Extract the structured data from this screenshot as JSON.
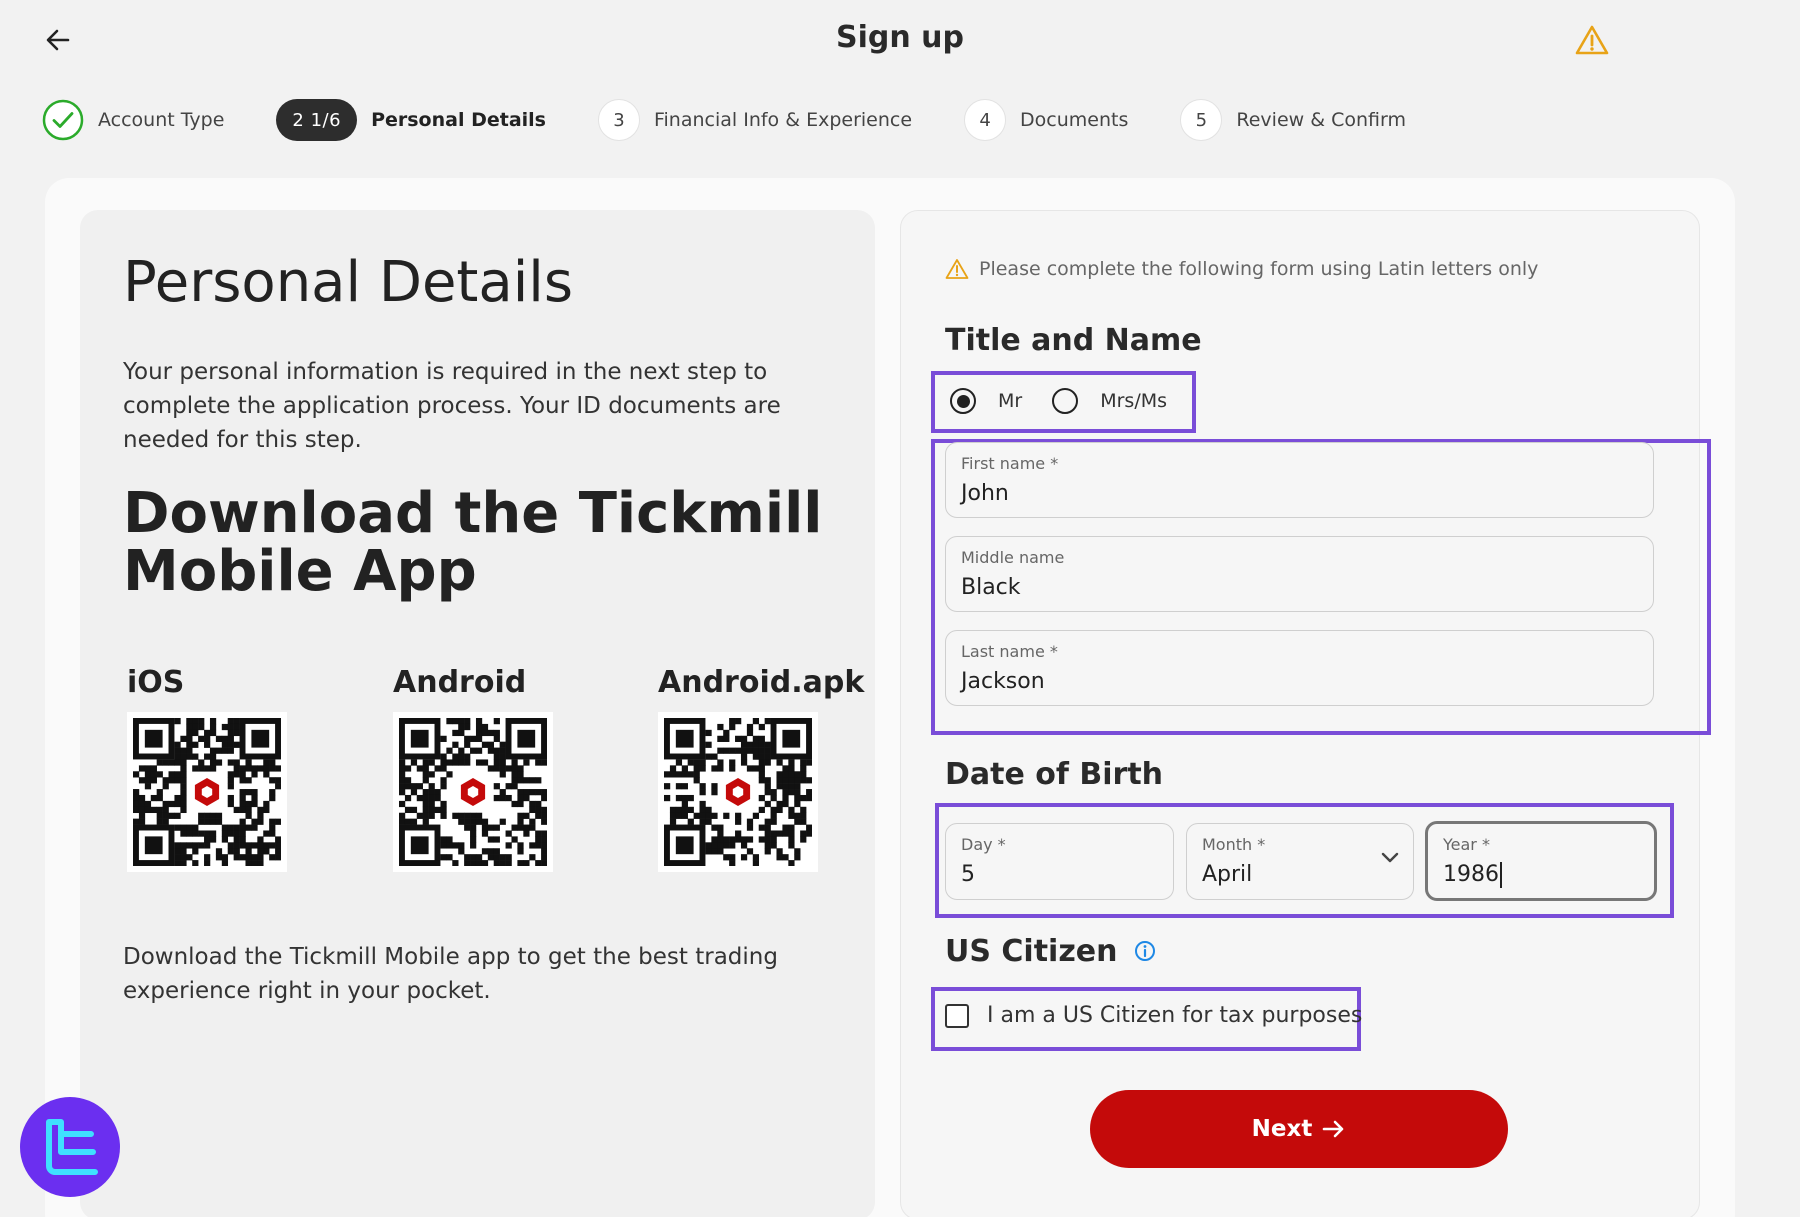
{
  "header": {
    "title": "Sign up"
  },
  "stepper": {
    "steps": [
      {
        "num": "",
        "label": "Account Type",
        "state": "done"
      },
      {
        "num": "2  1/6",
        "label": "Personal Details",
        "state": "active"
      },
      {
        "num": "3",
        "label": "Financial Info & Experience",
        "state": "pending"
      },
      {
        "num": "4",
        "label": "Documents",
        "state": "pending"
      },
      {
        "num": "5",
        "label": "Review & Confirm",
        "state": "pending"
      }
    ]
  },
  "left": {
    "heading": "Personal Details",
    "intro": "Your personal information is required in the next step to complete the application process. Your ID documents are needed for this step.",
    "download_heading": "Download the Tickmill Mobile App",
    "qr": [
      {
        "label": "iOS"
      },
      {
        "label": "Android"
      },
      {
        "label": "Android.apk"
      }
    ],
    "outro": "Download the Tickmill Mobile app to get the best trading experience right in your pocket."
  },
  "form": {
    "notice": "Please complete the following form using Latin letters only",
    "title_section": "Title and Name",
    "title_options": [
      {
        "label": "Mr",
        "selected": true
      },
      {
        "label": "Mrs/Ms",
        "selected": false
      }
    ],
    "first_name": {
      "label": "First name *",
      "value": "John"
    },
    "middle_name": {
      "label": "Middle name",
      "value": "Black"
    },
    "last_name": {
      "label": "Last name *",
      "value": "Jackson"
    },
    "dob_section": "Date of Birth",
    "day": {
      "label": "Day *",
      "value": "5"
    },
    "month": {
      "label": "Month *",
      "value": "April"
    },
    "year": {
      "label": "Year *",
      "value": "1986"
    },
    "us_section": "US Citizen",
    "us_checkbox_label": "I am a US Citizen for tax purposes",
    "us_checked": false,
    "next_label": "Next"
  },
  "colors": {
    "accent_red": "#c40a0a",
    "highlight_purple": "#7a4dd8",
    "check_green": "#2bab2b",
    "warning_orange": "#e8a317",
    "info_blue": "#1e88e5"
  }
}
